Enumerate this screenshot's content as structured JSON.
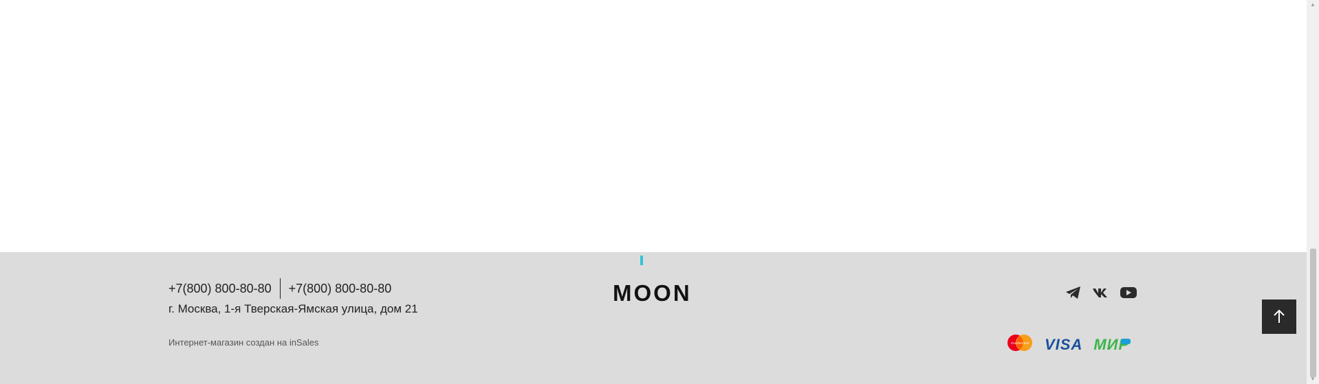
{
  "footer": {
    "phone_1": "+7(800) 800-80-80",
    "phone_2": "+7(800) 800-80-80",
    "address": "г. Москва, 1-я Тверская-Ямская улица, дом 21",
    "credit_prefix": "Интернет-магазин создан на ",
    "credit_link": "inSales",
    "logo": "MOON",
    "socials": [
      "telegram-icon",
      "vk-icon",
      "youtube-icon"
    ],
    "payments": {
      "mastercard_text": "mastercard",
      "visa": "VISA",
      "mir": "МИР"
    }
  },
  "colors": {
    "footer_bg": "#dcdcdc",
    "accent": "#35c3d4",
    "to_top_bg": "#2a2a2a",
    "visa": "#1a4f9c",
    "mir": "#3bb54a"
  }
}
